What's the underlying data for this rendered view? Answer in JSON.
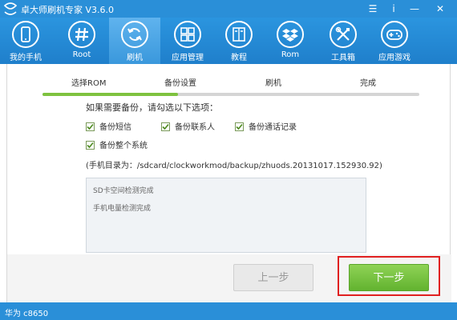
{
  "window": {
    "title": "卓大师刷机专家 V3.6.0",
    "logo_icon": "zhuo-logo-icon",
    "controls": [
      "menu-icon",
      "info-icon",
      "minimize-icon",
      "close-icon"
    ],
    "control_glyphs": [
      "☰",
      "i",
      "—",
      "✕"
    ]
  },
  "nav": {
    "items": [
      {
        "label": "我的手机",
        "icon": "phone-icon"
      },
      {
        "label": "Root",
        "icon": "hash-icon"
      },
      {
        "label": "刷机",
        "icon": "refresh-icon"
      },
      {
        "label": "应用管理",
        "icon": "grid-icon"
      },
      {
        "label": "教程",
        "icon": "book-icon"
      },
      {
        "label": "Rom",
        "icon": "dropbox-icon"
      },
      {
        "label": "工具箱",
        "icon": "tools-icon"
      },
      {
        "label": "应用游戏",
        "icon": "gamepad-icon"
      }
    ],
    "active_index": 2
  },
  "steps": {
    "items": [
      "选择ROM",
      "备份设置",
      "刷机",
      "完成"
    ],
    "current_index": 1,
    "progress_fraction": 0.36
  },
  "backup": {
    "question": "如果需要备份，请勾选以下选项：",
    "options": [
      {
        "label": "备份短信",
        "checked": true
      },
      {
        "label": "备份联系人",
        "checked": true
      },
      {
        "label": "备份通话记录",
        "checked": true
      },
      {
        "label": "备份整个系统",
        "checked": true
      }
    ],
    "path_text": "(手机目录为：/sdcard/clockworkmod/backup/zhuods.20131017.152930.92)"
  },
  "log": {
    "lines": [
      "SD卡空间检测完成",
      "手机电量检测完成"
    ]
  },
  "buttons": {
    "prev_label": "上一步",
    "next_label": "下一步"
  },
  "status": {
    "device": "华为 c8650"
  },
  "colors": {
    "brand_blue": "#2a8fd8",
    "progress_green": "#7ec23f",
    "next_green": "#62b32f",
    "highlight_red": "#e02020"
  }
}
